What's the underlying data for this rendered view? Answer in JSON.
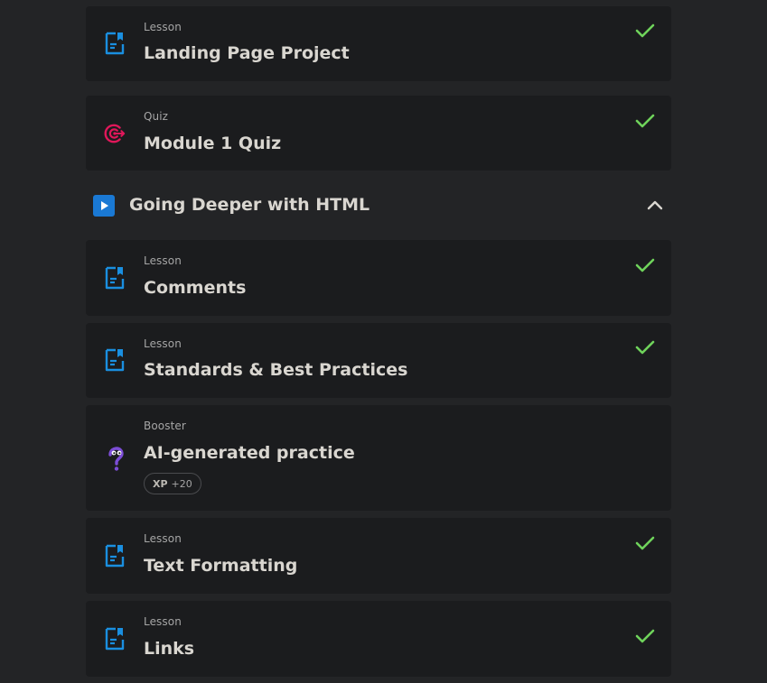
{
  "colors": {
    "page_bg": "#232426",
    "card_bg": "#1b1c1e",
    "lesson_icon": "#1a8fe0",
    "quiz_icon": "#e0175a",
    "booster_icon": "#7c4dd6",
    "check": "#6fd35b",
    "section_icon_bg": "#1a79d4"
  },
  "items_before": [
    {
      "type": "Lesson",
      "title": "Landing Page Project",
      "icon": "lesson-doc-icon",
      "completed": true
    },
    {
      "type": "Quiz",
      "title": "Module 1 Quiz",
      "icon": "quiz-target-icon",
      "completed": true
    }
  ],
  "section": {
    "title": "Going Deeper with HTML",
    "icon": "play-icon",
    "toggle_icon": "chevron-up-icon",
    "expanded": true
  },
  "items_after": [
    {
      "type": "Lesson",
      "title": "Comments",
      "icon": "lesson-doc-icon",
      "completed": true
    },
    {
      "type": "Lesson",
      "title": "Standards & Best Practices",
      "icon": "lesson-doc-icon",
      "completed": true
    },
    {
      "type": "Booster",
      "title": "AI-generated practice",
      "icon": "booster-question-icon",
      "completed": false,
      "xp_label": "XP",
      "xp_value": "+20"
    },
    {
      "type": "Lesson",
      "title": "Text Formatting",
      "icon": "lesson-doc-icon",
      "completed": true
    },
    {
      "type": "Lesson",
      "title": "Links",
      "icon": "lesson-doc-icon",
      "completed": true
    }
  ]
}
